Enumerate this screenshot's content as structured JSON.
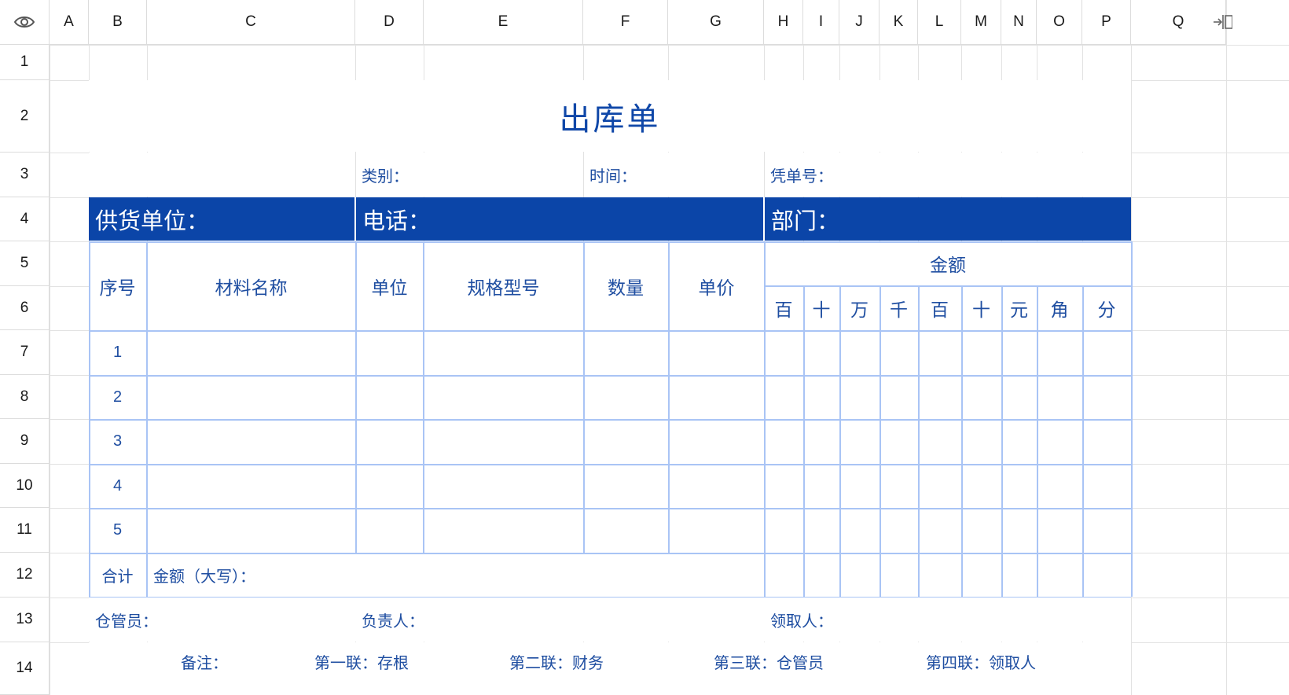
{
  "columns": [
    "A",
    "B",
    "C",
    "D",
    "E",
    "F",
    "G",
    "H",
    "I",
    "J",
    "K",
    "L",
    "M",
    "N",
    "O",
    "P",
    "Q"
  ],
  "rows": [
    "1",
    "2",
    "3",
    "4",
    "5",
    "6",
    "7",
    "8",
    "9",
    "10",
    "11",
    "12",
    "13",
    "14"
  ],
  "form": {
    "title": "出库单",
    "category_label": "类别：",
    "time_label": "时间：",
    "voucher_label": "凭单号：",
    "supplier_label": "供货单位：",
    "phone_label": "电话：",
    "department_label": "部门：",
    "headers": {
      "seq": "序号",
      "material": "材料名称",
      "unit": "单位",
      "spec": "规格型号",
      "qty": "数量",
      "price": "单价",
      "amount": "金额"
    },
    "digits": [
      "百",
      "十",
      "万",
      "千",
      "百",
      "十",
      "元",
      "角",
      "分"
    ],
    "item_numbers": [
      "1",
      "2",
      "3",
      "4",
      "5"
    ],
    "total_label": "合计",
    "amount_words_label": "金额（大写）：",
    "warehouse_keeper_label": "仓管员：",
    "manager_label": "负责人：",
    "receiver_label": "领取人：",
    "footer_note": [
      "备注：",
      "第一联：存根",
      "第二联：财务",
      "第三联：仓管员",
      "第四联：领取人"
    ]
  },
  "colors": {
    "accent": "#0b45a8",
    "text": "#1f4ea1",
    "border": "#a9c4f5"
  }
}
